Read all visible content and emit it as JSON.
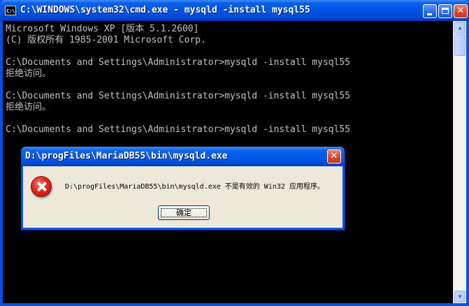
{
  "window": {
    "title": "C:\\WINDOWS\\system32\\cmd.exe - mysqld -install mysql55",
    "icon_label": "C:\\"
  },
  "console": {
    "lines": [
      "Microsoft Windows XP [版本 5.1.2600]",
      "(C) 版权所有 1985-2001 Microsoft Corp.",
      "",
      "C:\\Documents and Settings\\Administrator>mysqld -install mysql55",
      "拒绝访问。",
      "",
      "C:\\Documents and Settings\\Administrator>mysqld -install mysql55",
      "拒绝访问。",
      "",
      "C:\\Documents and Settings\\Administrator>mysqld -install mysql55"
    ]
  },
  "dialog": {
    "title": "D:\\progFiles\\MariaDB55\\bin\\mysqld.exe",
    "message": "D:\\progFiles\\MariaDB55\\bin\\mysqld.exe 不是有效的 Win32 应用程序。",
    "ok_label": "确定",
    "icon": "error-icon",
    "close_glyph": "✕"
  },
  "titlebar_buttons": {
    "close_glyph": "✕"
  },
  "colors": {
    "console_bg": "#000000",
    "console_text": "#c0c0c0",
    "titlebar_blue": "#0054e3",
    "dialog_face": "#ece9d8"
  }
}
